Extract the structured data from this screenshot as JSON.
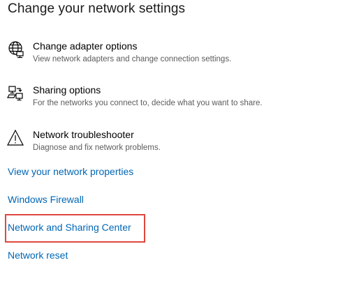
{
  "page": {
    "title": "Change your network settings"
  },
  "options": [
    {
      "icon": "globe-network-icon",
      "title": "Change adapter options",
      "description": "View network adapters and change connection settings."
    },
    {
      "icon": "sharing-icon",
      "title": "Sharing options",
      "description": "For the networks you connect to, decide what you want to share."
    },
    {
      "icon": "warning-icon",
      "title": "Network troubleshooter",
      "description": "Diagnose and fix network problems."
    }
  ],
  "links": {
    "network_properties": "View your network properties",
    "windows_firewall": "Windows Firewall",
    "network_sharing_center": "Network and Sharing Center",
    "network_reset": "Network reset"
  },
  "colors": {
    "link": "#0066b4",
    "highlight": "#e0473c",
    "description": "#5c5c5c"
  }
}
